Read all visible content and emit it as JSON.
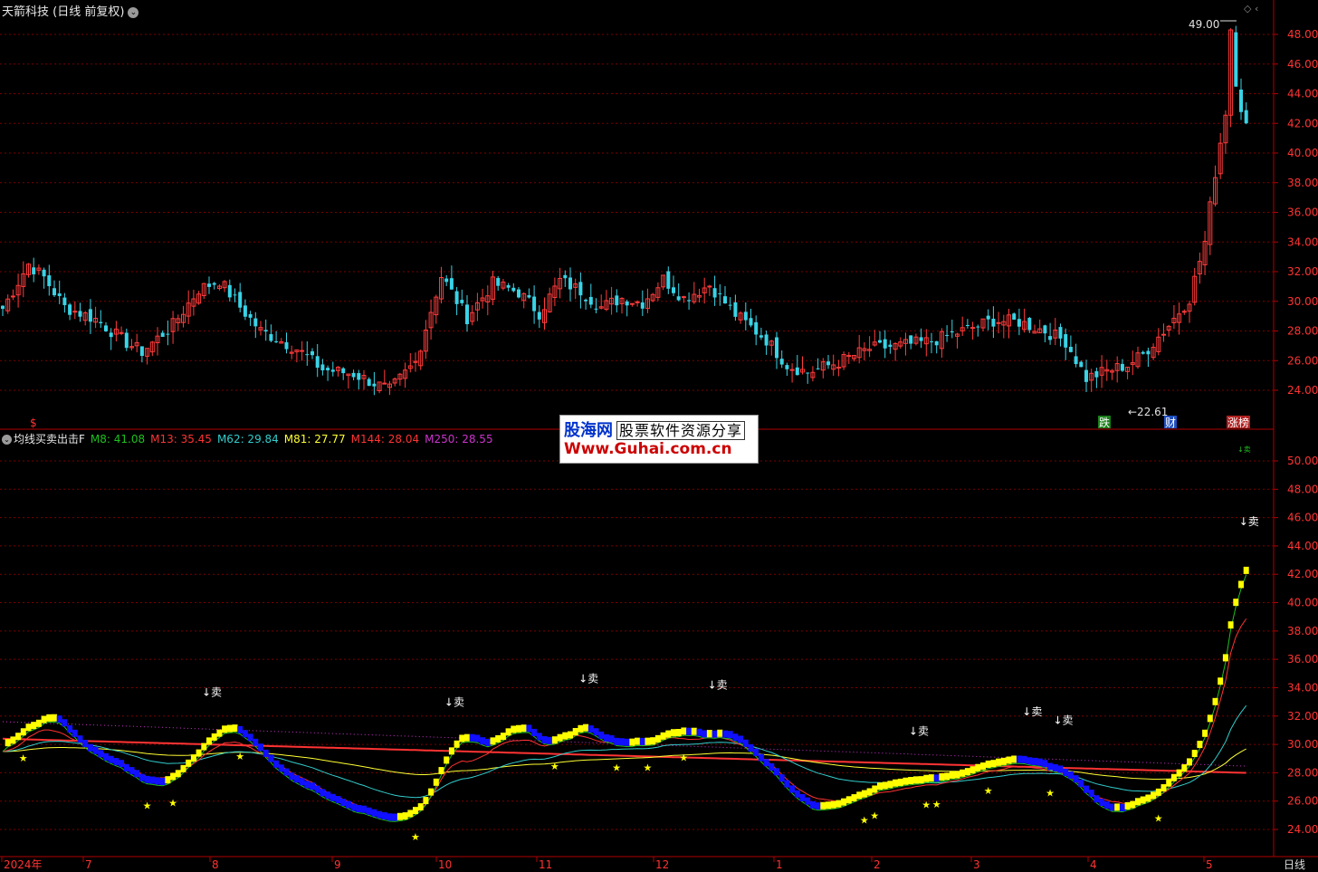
{
  "stock": {
    "title": "天箭科技 (日线 前复权)",
    "high_marker": "49.00",
    "low_marker": "22.61"
  },
  "price_axis": {
    "labels": [
      "48.00",
      "46.00",
      "44.00",
      "42.00",
      "40.00",
      "38.00",
      "36.00",
      "34.00",
      "32.00",
      "30.00",
      "28.00",
      "26.00",
      "24.00"
    ]
  },
  "indicator": {
    "name": "均线买卖出击F",
    "values": [
      {
        "label": "M8: 41.08",
        "color": "#1fbf1f"
      },
      {
        "label": "M13: 35.45",
        "color": "#ff3333"
      },
      {
        "label": "M62: 29.84",
        "color": "#33cccc"
      },
      {
        "label": "M81: 27.77",
        "color": "#ffff33"
      },
      {
        "label": "M144: 28.04",
        "color": "#ff3333"
      },
      {
        "label": "M250: 28.55",
        "color": "#cc33cc"
      }
    ],
    "axis_labels": [
      "50.00",
      "48.00",
      "46.00",
      "44.00",
      "42.00",
      "40.00",
      "38.00",
      "36.00",
      "34.00",
      "32.00",
      "30.00",
      "28.00",
      "26.00",
      "24.00"
    ],
    "sell_label": "↓卖",
    "buy_marker": "★",
    "top_small_label": "↓卖"
  },
  "event_badges": [
    {
      "label": "$",
      "color": "#ff3333",
      "bg": "none"
    },
    {
      "label": "跌",
      "color": "#ffffff",
      "bg": "#1a7f1a"
    },
    {
      "label": "财",
      "color": "#ffffff",
      "bg": "#1f4fbf"
    },
    {
      "label": "涨榜",
      "color": "#ffffff",
      "bg": "#b02020"
    }
  ],
  "time_axis": {
    "labels": [
      "2024年",
      "7",
      "8",
      "9",
      "10",
      "11",
      "12",
      "1",
      "2",
      "3",
      "4",
      "5"
    ],
    "period": "日线"
  },
  "watermark": {
    "line1_brand": "股海网",
    "line1_slogan": "股票软件资源分享",
    "line2": "Www.Guhai.com.cn"
  },
  "colors": {
    "up": "#ff3b3b",
    "down": "#39d3e6",
    "grid": "#7a0000",
    "axis_text": "#ff3333"
  }
}
